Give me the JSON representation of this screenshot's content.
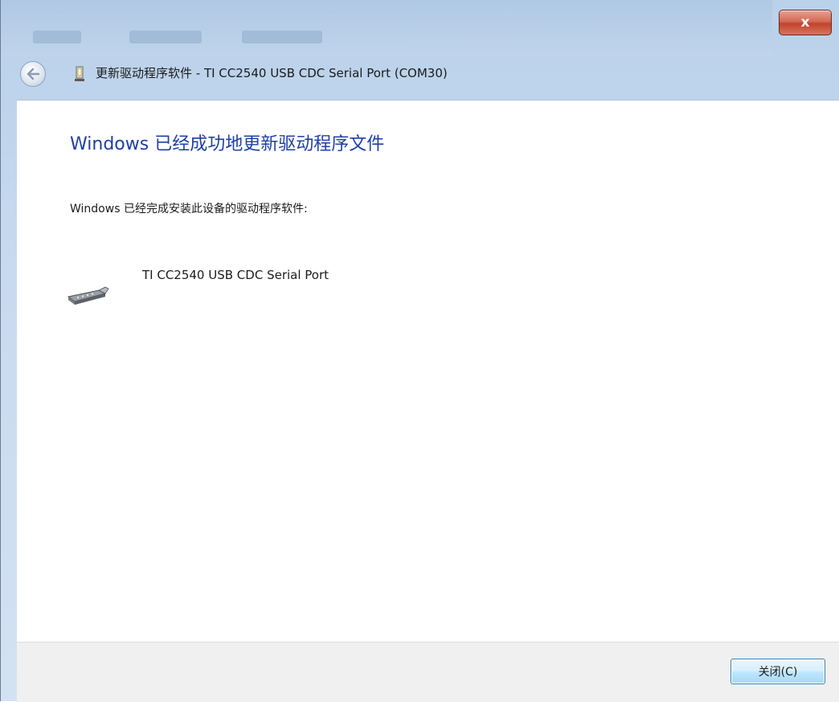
{
  "window": {
    "title": "更新驱动程序软件 - TI CC2540 USB CDC Serial Port (COM30)",
    "close_glyph": "x"
  },
  "content": {
    "heading": "Windows 已经成功地更新驱动程序文件",
    "subtext": "Windows 已经完成安装此设备的驱动程序软件:",
    "device_name": "TI CC2540 USB CDC Serial Port"
  },
  "footer": {
    "close_label": "关闭(C)"
  },
  "colors": {
    "heading": "#1f3fa5",
    "chrome": "#c8daef",
    "close_red": "#c2432c"
  },
  "icons": {
    "back": "back-arrow-icon",
    "device_small": "device-icon",
    "device_large": "serial-port-icon"
  }
}
